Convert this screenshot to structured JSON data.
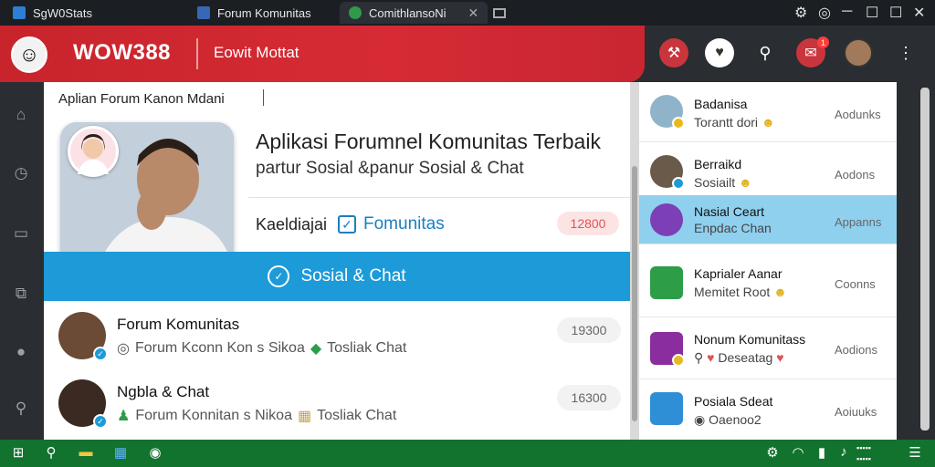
{
  "tabs": [
    {
      "label": "SgW0Stats",
      "color": "#2d7fd3"
    },
    {
      "label": "Forum Komunitas",
      "color": "#3867b5"
    },
    {
      "label": "ComithlansoNi",
      "color": "#2f9a4a"
    }
  ],
  "app": {
    "brand": "WOW388",
    "subtitle": "Eowit Mottat",
    "accent": "#d62b35",
    "notification_count": "1"
  },
  "main": {
    "breadcrumb": "Aplian Forum Kanon Mdani",
    "hero": {
      "title": "Aplikasi Forumnel Komunitas Terbaik",
      "subtitle": "partur Sosial &panur Sosial & Chat",
      "category_label": "Kaeldiajai",
      "category_value": "Fomunitas",
      "count": "12800"
    },
    "banner": "Sosial & Chat",
    "posts": [
      {
        "title": "Forum Komunitas",
        "left": "Forum Kconn Kon s Sikoa",
        "right": "Tosliak Chat",
        "count": "19300"
      },
      {
        "title": "Ngbla & Chat",
        "left": "Forum Konnitan s Nikoa",
        "right": "Tosliak Chat",
        "count": "16300"
      }
    ]
  },
  "sidebar_right": {
    "items": [
      {
        "title": "Badanisa",
        "subtitle": "Torantt dori",
        "action": "Aodunks",
        "selected": false,
        "icon_color": "#8fb4c9"
      },
      {
        "title": "Berraikd",
        "subtitle": "Sosiailt",
        "action": "Aodons",
        "selected": false,
        "icon_color": "#6a5a4a"
      },
      {
        "title": "Nasial Ceart",
        "subtitle": "Enpdac Chan",
        "action": "Appanns",
        "selected": true,
        "icon_color": "#7c3fb6"
      },
      {
        "title": "Kaprialer Aanar",
        "subtitle": "Memitet Root",
        "action": "Coonns",
        "selected": false,
        "icon_color": "#2d9d48"
      },
      {
        "title": "Nonum Komunitass",
        "subtitle": "Deseatag",
        "action": "Aodions",
        "selected": false,
        "icon_color": "#8a2d9e"
      },
      {
        "title": "Posiala Sdeat",
        "subtitle": "Oaenoo2",
        "action": "Aoiuuks",
        "selected": false,
        "icon_color": "#2f8fd6"
      }
    ]
  }
}
